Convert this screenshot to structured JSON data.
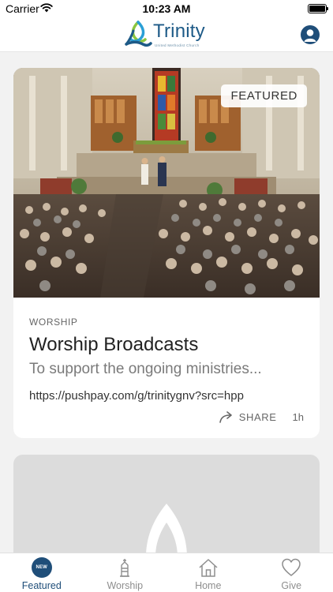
{
  "status_bar": {
    "carrier": "Carrier",
    "time": "10:23 AM"
  },
  "header": {
    "logo_name": "Trinity",
    "logo_subtitle": "United Methodist Church"
  },
  "feed": {
    "featured_card": {
      "badge": "FEATURED",
      "category": "WORSHIP",
      "title": "Worship Broadcasts",
      "subtitle": "To support the ongoing ministries...",
      "link": "https://pushpay.com/g/trinitygnv?src=hpp",
      "share_label": "SHARE",
      "time_ago": "1h"
    }
  },
  "tab_bar": {
    "tabs": [
      {
        "label": "Featured",
        "icon": "new-badge-icon",
        "badge": "NEW",
        "active": true
      },
      {
        "label": "Worship",
        "icon": "church-icon",
        "active": false
      },
      {
        "label": "Home",
        "icon": "house-icon",
        "active": false
      },
      {
        "label": "Give",
        "icon": "heart-icon",
        "active": false
      }
    ]
  },
  "colors": {
    "accent": "#1f4e79",
    "inactive": "#8e8e8e",
    "background": "#f2f2f2"
  }
}
